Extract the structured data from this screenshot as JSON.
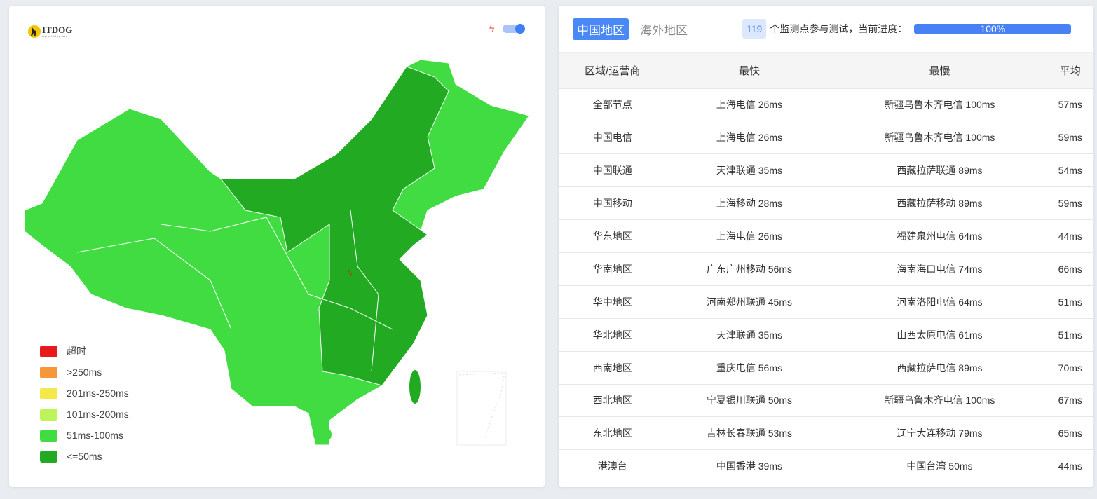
{
  "logo": {
    "name": "ITDOG",
    "url_text": "www.itdog.cn"
  },
  "legend": [
    {
      "label": "超时",
      "color": "#e8191a"
    },
    {
      "label": ">250ms",
      "color": "#f6973a"
    },
    {
      "label": "201ms-250ms",
      "color": "#f4e94a"
    },
    {
      "label": "101ms-200ms",
      "color": "#bdf45b"
    },
    {
      "label": "51ms-100ms",
      "color": "#41dc41"
    },
    {
      "label": "<=50ms",
      "color": "#22aa22"
    }
  ],
  "tabs": [
    {
      "label": "中国地区",
      "active": true
    },
    {
      "label": "海外地区",
      "active": false
    }
  ],
  "status": {
    "count": "119",
    "text": "个监测点参与测试，当前进度：",
    "progress_label": "100%",
    "progress": 100
  },
  "table": {
    "headers": [
      "区域/运营商",
      "最快",
      "最慢",
      "平均"
    ],
    "rows": [
      [
        "全部节点",
        "上海电信 26ms",
        "新疆乌鲁木齐电信 100ms",
        "57ms"
      ],
      [
        "中国电信",
        "上海电信 26ms",
        "新疆乌鲁木齐电信 100ms",
        "59ms"
      ],
      [
        "中国联通",
        "天津联通 35ms",
        "西藏拉萨联通 89ms",
        "54ms"
      ],
      [
        "中国移动",
        "上海移动 28ms",
        "西藏拉萨移动 89ms",
        "59ms"
      ],
      [
        "华东地区",
        "上海电信 26ms",
        "福建泉州电信 64ms",
        "44ms"
      ],
      [
        "华南地区",
        "广东广州移动 56ms",
        "海南海口电信 74ms",
        "66ms"
      ],
      [
        "华中地区",
        "河南郑州联通 45ms",
        "河南洛阳电信 64ms",
        "51ms"
      ],
      [
        "华北地区",
        "天津联通 35ms",
        "山西太原电信 61ms",
        "51ms"
      ],
      [
        "西南地区",
        "重庆电信 56ms",
        "西藏拉萨电信 89ms",
        "70ms"
      ],
      [
        "西北地区",
        "宁夏银川联通 50ms",
        "新疆乌鲁木齐电信 100ms",
        "67ms"
      ],
      [
        "东北地区",
        "吉林长春联通 53ms",
        "辽宁大连移动 79ms",
        "65ms"
      ],
      [
        "港澳台",
        "中国香港 39ms",
        "中国台湾 50ms",
        "44ms"
      ]
    ]
  }
}
